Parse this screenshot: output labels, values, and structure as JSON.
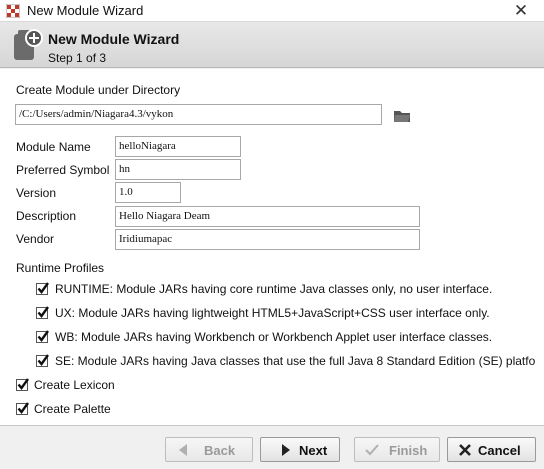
{
  "window": {
    "title": "New Module Wizard",
    "close_glyph": "✕"
  },
  "banner": {
    "title": "New Module Wizard",
    "step": "Step 1 of 3",
    "icon": "module-add-icon"
  },
  "form": {
    "directory": {
      "label": "Create Module under Directory",
      "value": "/C:/Users/admin/Niagara4.3/vykon",
      "browse_icon": "folder-icon"
    },
    "module_name": {
      "label": "Module Name",
      "value": "helloNiagara"
    },
    "preferred_symbol": {
      "label": "Preferred Symbol",
      "value": "hn"
    },
    "version": {
      "label": "Version",
      "value": "1.0"
    },
    "description": {
      "label": "Description",
      "value": "Hello Niagara Deam"
    },
    "vendor": {
      "label": "Vendor",
      "value": "Iridiumapac"
    }
  },
  "runtime_profiles": {
    "label": "Runtime Profiles",
    "items": [
      {
        "label": "RUNTIME: Module JARs having core runtime Java classes only, no user interface.",
        "checked": true
      },
      {
        "label": "UX: Module JARs having lightweight HTML5+JavaScript+CSS user interface only.",
        "checked": true
      },
      {
        "label": "WB: Module JARs having Workbench or Workbench Applet user interface classes.",
        "checked": true
      },
      {
        "label": "SE: Module JARs having Java classes that use the full Java 8 Standard Edition (SE) platfo",
        "checked": true
      }
    ]
  },
  "options": {
    "create_lexicon": {
      "label": "Create Lexicon",
      "checked": true
    },
    "create_palette": {
      "label": "Create Palette",
      "checked": true
    }
  },
  "buttons": {
    "back": {
      "label": "Back",
      "enabled": false
    },
    "next": {
      "label": "Next",
      "enabled": true
    },
    "finish": {
      "label": "Finish",
      "enabled": false
    },
    "cancel": {
      "label": "Cancel",
      "enabled": true
    }
  },
  "colors": {
    "check": "#111111",
    "disabled_text": "#9a9a9a",
    "banner": "#dcdcdc",
    "app_icon_red": "#c0392b"
  }
}
